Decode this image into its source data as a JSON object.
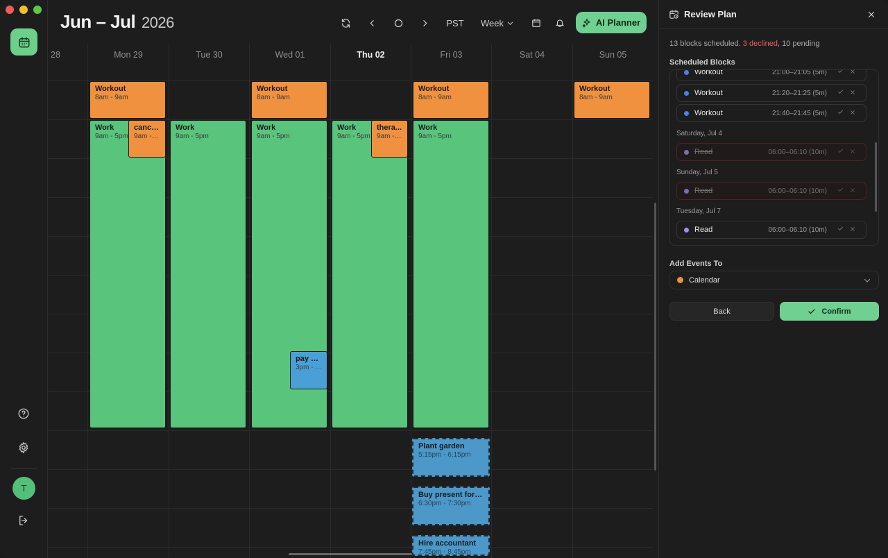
{
  "header": {
    "title_months": "Jun – Jul",
    "title_year": "2026",
    "timezone": "PST",
    "view": "Week",
    "ai_planner": "AI Planner"
  },
  "rail": {
    "avatar_initial": "T"
  },
  "days": [
    {
      "label": "28",
      "today": false
    },
    {
      "label": "Mon 29",
      "today": false
    },
    {
      "label": "Tue 30",
      "today": false
    },
    {
      "label": "Wed 01",
      "today": false
    },
    {
      "label": "Thu 02",
      "today": true
    },
    {
      "label": "Fri 03",
      "today": false
    },
    {
      "label": "Sat 04",
      "today": false
    },
    {
      "label": "Sun 05",
      "today": false
    }
  ],
  "events": [
    {
      "title": "Workout",
      "time": "8am - 9am",
      "color": "orange"
    },
    {
      "title": "Workout",
      "time": "8am - 9am",
      "color": "orange"
    },
    {
      "title": "Workout",
      "time": "8am - 9am",
      "color": "orange"
    },
    {
      "title": "Workout",
      "time": "8am - 9am",
      "color": "orange"
    },
    {
      "title": "Work",
      "time": "9am - 5pm",
      "color": "green"
    },
    {
      "title": "cance...",
      "time": "9am - 1...",
      "color": "orange"
    },
    {
      "title": "Work",
      "time": "9am - 5pm",
      "color": "green"
    },
    {
      "title": "Work",
      "time": "9am - 5pm",
      "color": "green"
    },
    {
      "title": "Work",
      "time": "9am - 5pm",
      "color": "green"
    },
    {
      "title": "thera...",
      "time": "9am - 1...",
      "color": "orange"
    },
    {
      "title": "Work",
      "time": "9am - 5pm",
      "color": "green"
    },
    {
      "title": "pay bi...",
      "time": "3pm - ...",
      "color": "blue"
    },
    {
      "title": "Plant garden",
      "time": "5:15pm - 6:15pm",
      "color": "dashed"
    },
    {
      "title": "Buy present for J...",
      "time": "6:30pm - 7:30pm",
      "color": "dashed"
    },
    {
      "title": "Hire accountant",
      "time": "7:45pm - 8:45pm",
      "color": "dashed"
    }
  ],
  "panel": {
    "title": "Review Plan",
    "summary_scheduled": "13 blocks scheduled. ",
    "summary_declined": "3 declined",
    "summary_pending": ", 10 pending",
    "scheduled_label": "Scheduled Blocks",
    "blocks": [
      {
        "name": "Workout",
        "time": "21:00–21:05 (5m)",
        "dot": "#4f7df0",
        "declined": false
      },
      {
        "name": "Workout",
        "time": "21:20–21:25 (5m)",
        "dot": "#4f7df0",
        "declined": false
      },
      {
        "name": "Workout",
        "time": "21:40–21:45 (5m)",
        "dot": "#4f7df0",
        "declined": false
      },
      {
        "name": "Read",
        "time": "06:00–06:10 (10m)",
        "dot": "#7a6fb0",
        "declined": true
      },
      {
        "name": "Read",
        "time": "06:00–06:10 (10m)",
        "dot": "#7a6fb0",
        "declined": true
      },
      {
        "name": "Read",
        "time": "06:00–06:10 (10m)",
        "dot": "#a78bfa",
        "declined": false
      }
    ],
    "day_labels": [
      "Saturday, Jul 4",
      "Sunday, Jul 5",
      "Tuesday, Jul 7"
    ],
    "add_events_label": "Add Events To",
    "calendar_option": "Calendar",
    "calendar_color": "#f0913f",
    "back": "Back",
    "confirm": "Confirm"
  },
  "colors": {
    "accent": "#6fd092",
    "event_orange": "#f0913f",
    "event_green": "#58c47c",
    "event_blue": "#4aa0d6",
    "declined": "#e86060"
  }
}
